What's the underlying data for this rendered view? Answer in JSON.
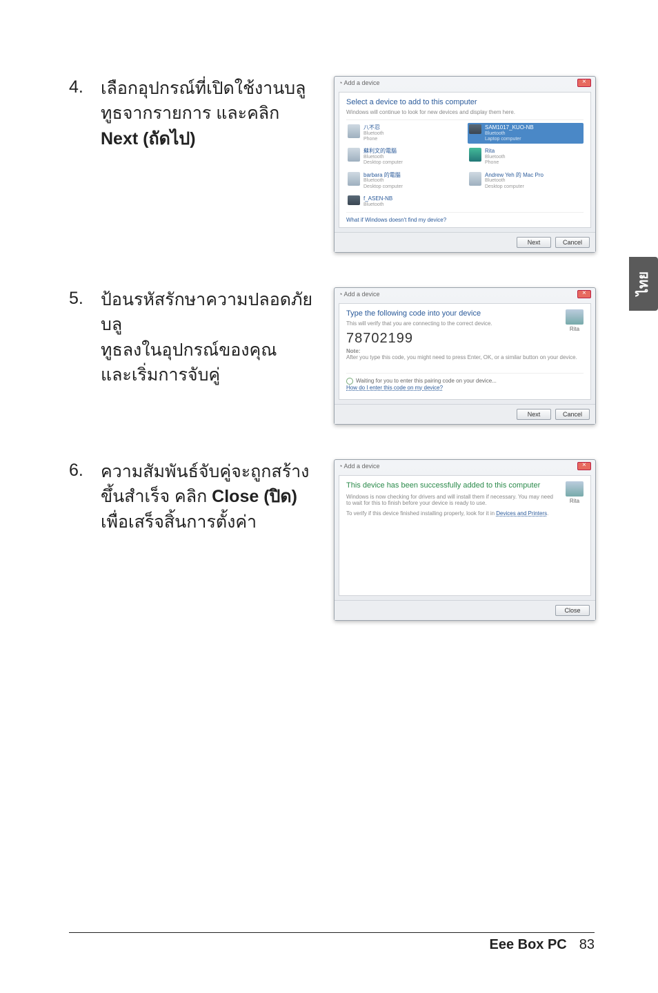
{
  "side_tab": "ไทย",
  "steps": {
    "s4": {
      "num": "4.",
      "text_line1": "เลือกอุปกรณ์ที่เปิดใช้งานบลู",
      "text_line2": "ทูธจากรายการ และคลิก",
      "text_bold": "Next (ถัดไป)"
    },
    "s5": {
      "num": "5.",
      "text_line1": "ป้อนรหัสรักษาความปลอดภัยบลู",
      "text_line2": "ทูธลงในอุปกรณ์ของคุณ",
      "text_line3": "และเริ่มการจับคู่"
    },
    "s6": {
      "num": "6.",
      "text_line1": "ความสัมพันธ์จับคู่จะถูกสร้าง",
      "text_line2a": "ขึ้นสำเร็จ คลิก ",
      "text_bold": "Close (ปิด)",
      "text_line3": "เพื่อเสร็จสิ้นการตั้งค่า"
    }
  },
  "dialog_common": {
    "title_prefix": "Add a device"
  },
  "dialog1": {
    "heading": "Select a device to add to this computer",
    "sub": "Windows will continue to look for new devices and display them here.",
    "devices": [
      {
        "name": "八不忍",
        "meta1": "Bluetooth",
        "meta2": "Phone"
      },
      {
        "name": "SAM1017_KUO-NB",
        "meta1": "Bluetooth",
        "meta2": "Laptop computer",
        "selected": true
      },
      {
        "name": "蘇利文的電腦",
        "meta1": "Bluetooth",
        "meta2": "Desktop computer"
      },
      {
        "name": "Rita",
        "meta1": "Bluetooth",
        "meta2": "Phone"
      },
      {
        "name": "barbara 的電腦",
        "meta1": "Bluetooth",
        "meta2": "Desktop computer"
      },
      {
        "name": "Andrew Yeh 的 Mac Pro",
        "meta1": "Bluetooth",
        "meta2": "Desktop computer"
      },
      {
        "name": "f_ASEN-NB",
        "meta1": "Bluetooth",
        "meta2": ""
      }
    ],
    "link": "What if Windows doesn't find my device?",
    "btn_next": "Next",
    "btn_cancel": "Cancel"
  },
  "dialog2": {
    "heading": "Type the following code into your device",
    "sub": "This will verify that you are connecting to the correct device.",
    "code": "78702199",
    "note_label": "Note:",
    "note": "After you type this code, you might need to press Enter, OK, or a similar button on your device.",
    "target_label": "Rita",
    "wait": "Waiting for you to enter this pairing code on your device...",
    "link": "How do I enter this code on my device?",
    "btn_next": "Next",
    "btn_cancel": "Cancel"
  },
  "dialog3": {
    "heading": "This device has been successfully added to this computer",
    "body1": "Windows is now checking for drivers and will install them if necessary. You may need to wait for this to finish before your device is ready to use.",
    "body2a": "To verify if this device finished installing properly, look for it in ",
    "body2b": "Devices and Printers",
    "target_label": "Rita",
    "btn_close": "Close"
  },
  "footer": {
    "product": "Eee Box PC",
    "page": "83"
  }
}
